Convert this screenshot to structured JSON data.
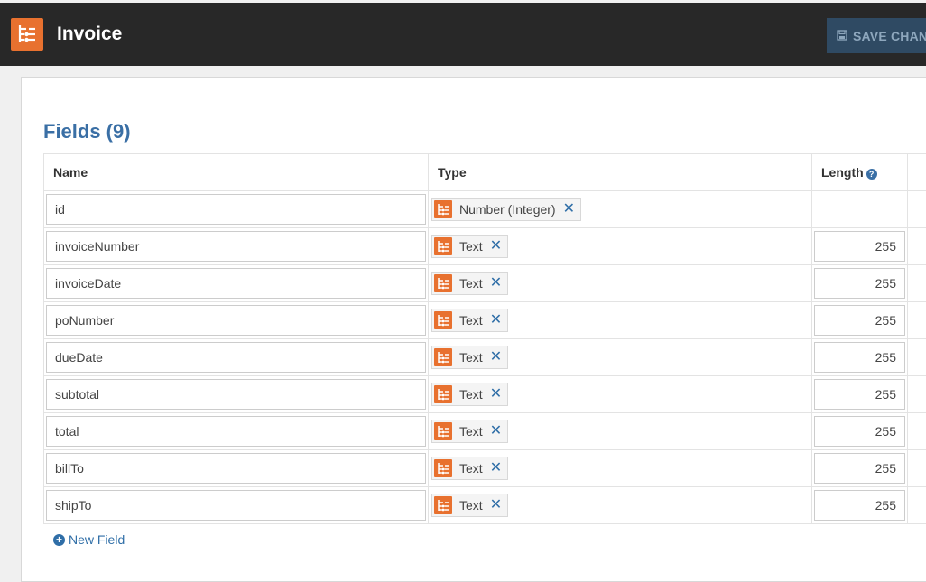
{
  "app": {
    "title": "Invoice",
    "save_label": "SAVE CHANGES",
    "brand_color": "#e8712f",
    "header_bg": "#282828"
  },
  "fields": {
    "heading": "Fields (9)",
    "columns": {
      "name": "Name",
      "type": "Type",
      "length": "Length"
    },
    "rows": [
      {
        "name": "id",
        "type": "Number (Integer)",
        "length": ""
      },
      {
        "name": "invoiceNumber",
        "type": "Text",
        "length": "255"
      },
      {
        "name": "invoiceDate",
        "type": "Text",
        "length": "255"
      },
      {
        "name": "poNumber",
        "type": "Text",
        "length": "255"
      },
      {
        "name": "dueDate",
        "type": "Text",
        "length": "255"
      },
      {
        "name": "subtotal",
        "type": "Text",
        "length": "255"
      },
      {
        "name": "total",
        "type": "Text",
        "length": "255"
      },
      {
        "name": "billTo",
        "type": "Text",
        "length": "255"
      },
      {
        "name": "shipTo",
        "type": "Text",
        "length": "255"
      }
    ],
    "new_field_label": "New Field",
    "icons": {
      "type": "field-type-icon",
      "remove": "remove-type-icon",
      "help": "help-icon",
      "add": "plus-icon"
    }
  }
}
